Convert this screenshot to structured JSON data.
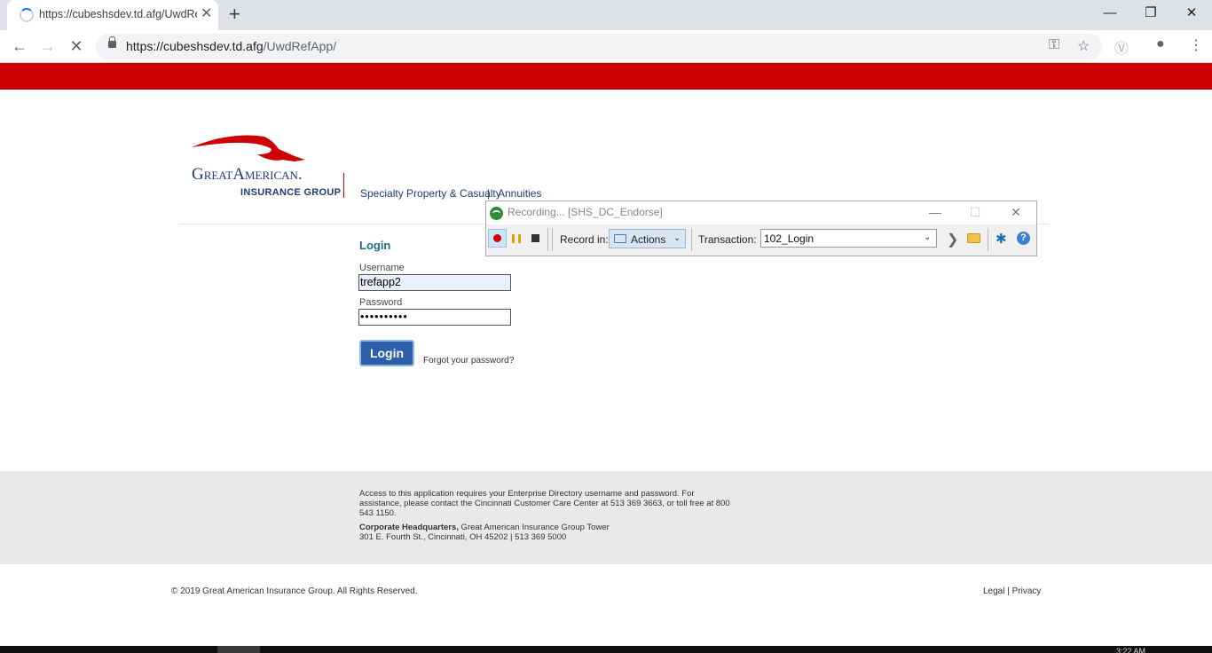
{
  "browser": {
    "tab_title": "https://cubeshsdev.td.afg/UwdRe",
    "tab_close_icon": "close-icon",
    "new_tab_symbol": "+",
    "url_host": "https://cubeshsdev.td.afg",
    "url_path": "/UwdRefApp/",
    "icons": [
      "back-icon",
      "forward-icon",
      "stop-icon",
      "lock-icon",
      "key-icon",
      "star-icon",
      "extension-icon",
      "profile-icon",
      "menu-icon"
    ]
  },
  "window_controls": {
    "minimize": "—",
    "restore": "❐",
    "close": "✕"
  },
  "header": {
    "logo_text": "GreatAmerican.",
    "logo_subtext": "INSURANCE GROUP",
    "links": [
      "Specialty Property & Casualty",
      "Annuities"
    ],
    "separator": "|"
  },
  "login": {
    "title": "Login",
    "username_label": "Username",
    "username_value": "trefapp2",
    "password_label": "Password",
    "password_value": "••••••••••",
    "login_button": "Login",
    "forgot_link": "Forgot your password?"
  },
  "footer": {
    "access_text": "Access to this application requires your Enterprise Directory username and password. For assistance, please contact the Cincinnati Customer Care Center at 513 369 3663, or toll free at 800 543 1150.",
    "hq_label": "Corporate Headquarters,",
    "hq_text": " Great American Insurance Group Tower",
    "address": "301 E. Fourth St., Cincinnati, OH 45202   |   513 369 5000",
    "copyright": "© 2019 Great American Insurance Group. All Rights Reserved.",
    "legal_links": "Legal | Privacy"
  },
  "recorder": {
    "title": "Recording... [SHS_DC_Endorse]",
    "record_in_label": "Record in:",
    "record_in_value": "Actions",
    "transaction_label": "Transaction:",
    "transaction_value": "102_Login",
    "help_symbol": "?"
  },
  "taskbar": {
    "clock": "3:22 AM"
  },
  "colors": {
    "brand_red": "#cc0000",
    "brand_navy": "#1f3c78",
    "login_blue": "#2d5ea8"
  }
}
